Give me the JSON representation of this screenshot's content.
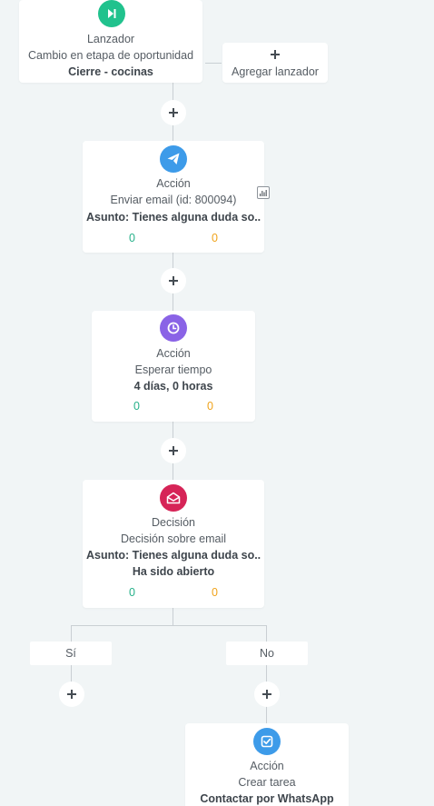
{
  "colors": {
    "background": "#f1f5f6",
    "connector": "#c9cfd3",
    "trigger_icon": "#21c28d",
    "email_icon": "#3d9be9",
    "wait_icon": "#8a63e6",
    "decision_icon": "#d62457",
    "task_icon": "#3d9be9",
    "stat_green": "#27b18a",
    "stat_orange": "#f0a31b"
  },
  "trigger": {
    "icon": "skip-forward-icon",
    "type": "Lanzador",
    "description": "Cambio en etapa de oportunidad",
    "value": "Cierre - cocinas"
  },
  "add_trigger": {
    "icon": "plus-icon",
    "label": "Agregar lanzador"
  },
  "action_email": {
    "icon": "paper-plane-icon",
    "type": "Acción",
    "description": "Enviar email (id: 800094)",
    "subject": "Asunto: Tienes alguna duda so...",
    "stat_green": "0",
    "stat_orange": "0",
    "report_icon": "bar-chart-icon"
  },
  "action_wait": {
    "icon": "clock-icon",
    "type": "Acción",
    "description": "Esperar tiempo",
    "value": "4 días, 0 horas",
    "stat_green": "0",
    "stat_orange": "0"
  },
  "decision": {
    "icon": "envelope-open-icon",
    "type": "Decisión",
    "description": "Decisión sobre email",
    "subject": "Asunto: Tienes alguna duda so...",
    "condition": "Ha sido abierto",
    "stat_green": "0",
    "stat_orange": "0"
  },
  "branches": {
    "yes_label": "Sí",
    "no_label": "No"
  },
  "action_task": {
    "icon": "check-square-icon",
    "type": "Acción",
    "description": "Crear tarea",
    "value": "Contactar por WhatsApp"
  }
}
